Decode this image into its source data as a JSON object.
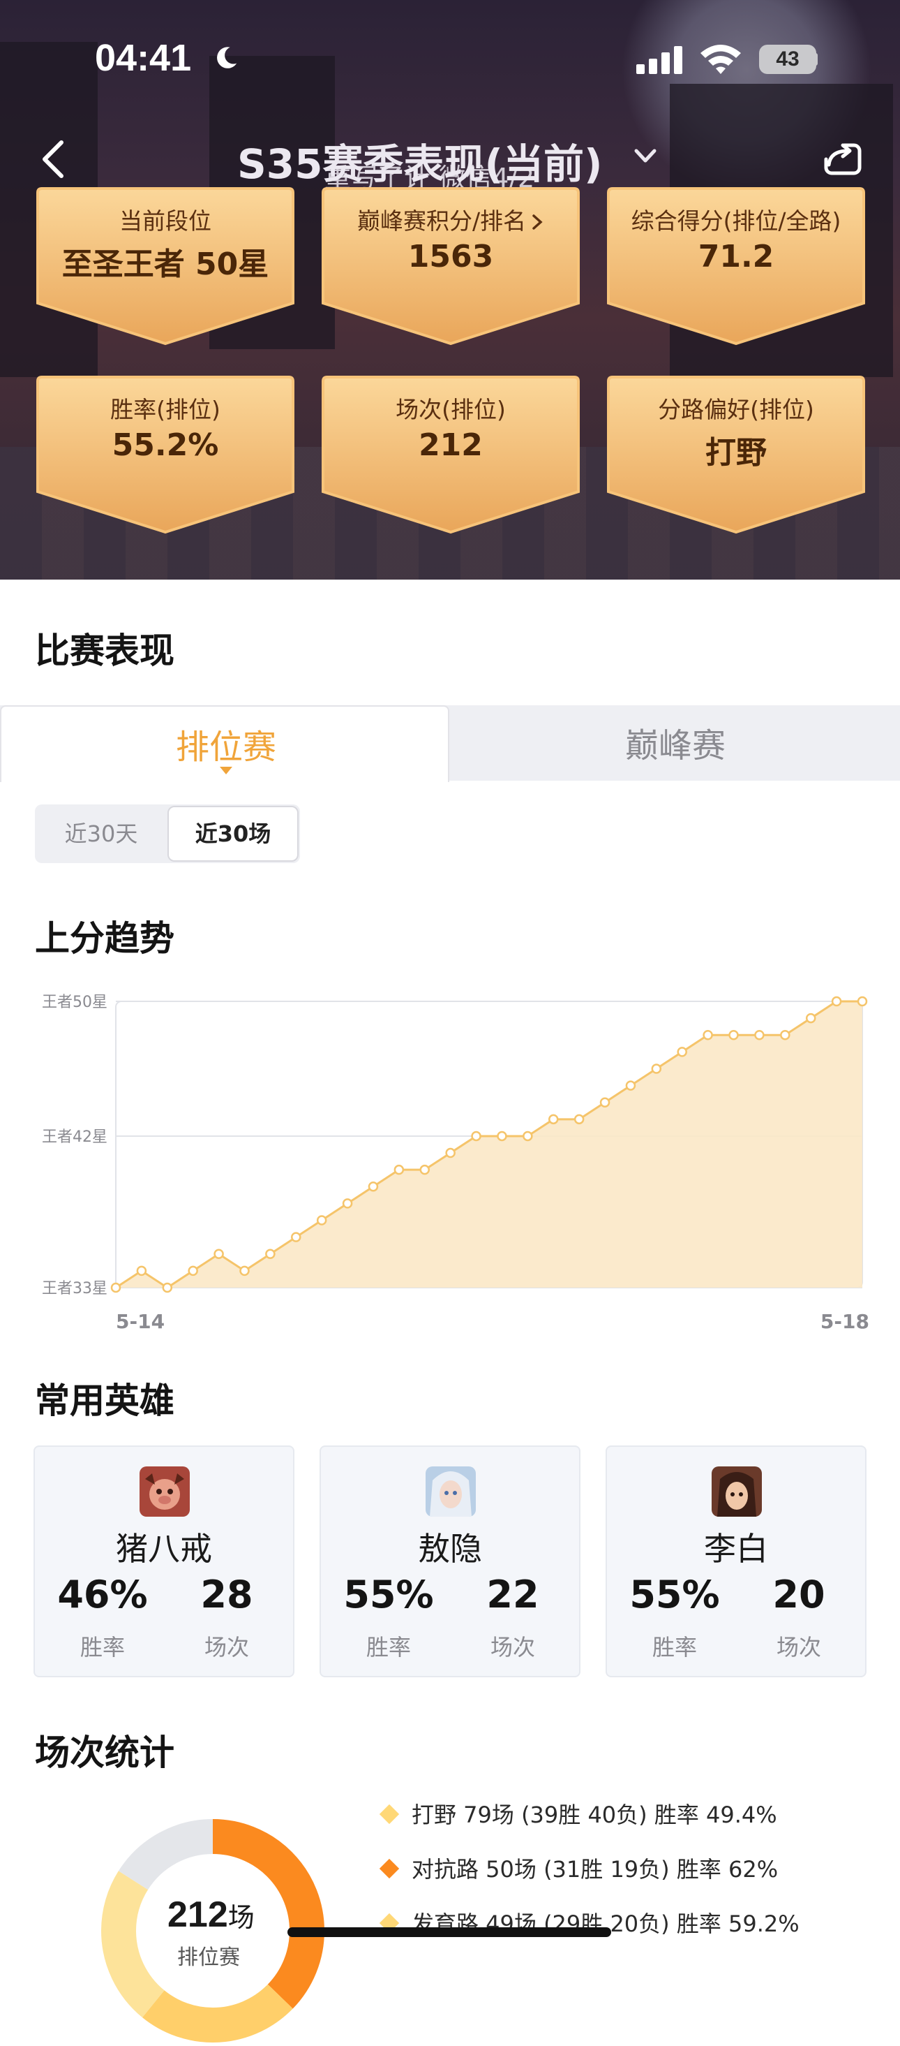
{
  "status_bar": {
    "time": "04:41",
    "battery": "43"
  },
  "header": {
    "title": "S35赛季表现(当前)",
    "overlap_text": "重写了计 微信4/2"
  },
  "stat_cards": [
    {
      "label": "当前段位",
      "value": "至圣王者 50星",
      "has_arrow": false
    },
    {
      "label": "巅峰赛积分/排名",
      "value": "1563",
      "has_arrow": true
    },
    {
      "label": "综合得分(排位/全路)",
      "value": "71.2",
      "has_arrow": false
    },
    {
      "label": "胜率(排位)",
      "value": "55.2%",
      "has_arrow": false
    },
    {
      "label": "场次(排位)",
      "value": "212",
      "has_arrow": false
    },
    {
      "label": "分路偏好(排位)",
      "value": "打野",
      "has_arrow": false
    }
  ],
  "match_section": {
    "title": "比赛表现",
    "tabs": [
      {
        "label": "排位赛",
        "active": true
      },
      {
        "label": "巅峰赛",
        "active": false
      }
    ],
    "segments": [
      {
        "label": "近30天",
        "active": false
      },
      {
        "label": "近30场",
        "active": true
      }
    ]
  },
  "trend": {
    "title": "上分趋势",
    "chart_data": {
      "type": "area",
      "y_ticks": [
        {
          "label": "王者50星",
          "value": 50
        },
        {
          "label": "王者42星",
          "value": 42
        },
        {
          "label": "王者33星",
          "value": 33
        }
      ],
      "ylim": [
        33,
        50
      ],
      "x_tick_labels": [
        "5-14",
        "5-18"
      ],
      "values": [
        33,
        34,
        33,
        34,
        35,
        34,
        35,
        36,
        37,
        38,
        39,
        40,
        40,
        41,
        42,
        42,
        42,
        43,
        43,
        44,
        45,
        46,
        47,
        48,
        48,
        48,
        48,
        49,
        50,
        50
      ],
      "grid": true,
      "color": "#f5c46a",
      "fill": "#fbe8c6"
    }
  },
  "heroes_section": {
    "title": "常用英雄",
    "heroes": [
      {
        "name": "猪八戒",
        "win_rate": "46%",
        "win_rate_label": "胜率",
        "games": "28",
        "games_label": "场次"
      },
      {
        "name": "敖隐",
        "win_rate": "55%",
        "win_rate_label": "胜率",
        "games": "22",
        "games_label": "场次"
      },
      {
        "name": "李白",
        "win_rate": "55%",
        "win_rate_label": "胜率",
        "games": "20",
        "games_label": "场次"
      }
    ]
  },
  "games_section": {
    "title": "场次统计",
    "total": "212",
    "total_unit": "场",
    "total_sub": "排位赛",
    "roles": [
      {
        "text": "打野 79场 (39胜 40负) 胜率 49.4%",
        "color": "#ffd877",
        "games": 79
      },
      {
        "text": "对抗路 50场 (31胜 19负) 胜率 62%",
        "color": "#fb8a1f",
        "games": 50
      },
      {
        "text": "发育路 49场 (29胜 20负) 胜率 59.2%",
        "color": "#ffd877",
        "games": 49
      }
    ],
    "donut": [
      {
        "value": 79,
        "color": "#fb8a1f"
      },
      {
        "value": 50,
        "color": "#ffcf6a"
      },
      {
        "value": 49,
        "color": "#fde39a"
      },
      {
        "value": 34,
        "color": "#e4e6ea"
      }
    ]
  }
}
